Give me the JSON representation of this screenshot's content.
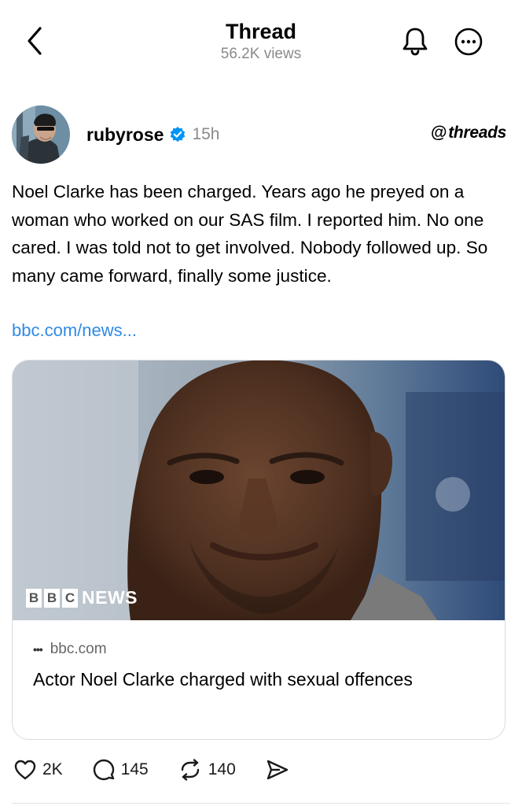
{
  "header": {
    "title": "Thread",
    "views": "56.2K views"
  },
  "post": {
    "username": "rubyrose",
    "verified": true,
    "timestamp": "15h",
    "brand": "threads",
    "text": "Noel Clarke has been charged. Years ago he preyed on a woman who worked on our SAS film. I reported him. No one cared. I was told not to get involved. Nobody followed up. So many came forward, finally some justice.",
    "link_text": "bbc.com/news..."
  },
  "card": {
    "image_overlay": {
      "letters": [
        "B",
        "B",
        "C"
      ],
      "word": "NEWS"
    },
    "domain": "bbc.com",
    "title": "Actor Noel Clarke charged with sexual offences"
  },
  "actions": {
    "likes": "2K",
    "replies": "145",
    "reposts": "140"
  },
  "colors": {
    "link": "#2f8ae6",
    "verified": "#0095f6",
    "muted": "#8a8a8a"
  }
}
